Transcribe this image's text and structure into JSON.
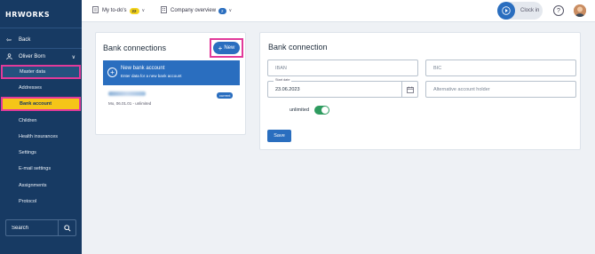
{
  "app": {
    "logo": "HRWORKS"
  },
  "sidebar": {
    "back_label": "Back",
    "user_label": "Oliver Born",
    "items": [
      {
        "label": "Master data"
      },
      {
        "label": "Addresses"
      },
      {
        "label": "Bank account"
      },
      {
        "label": "Children"
      },
      {
        "label": "Health insurances"
      },
      {
        "label": "Settings"
      },
      {
        "label": "E-mail settings"
      },
      {
        "label": "Assignments"
      },
      {
        "label": "Protocol"
      }
    ],
    "search_placeholder": "Search"
  },
  "topbar": {
    "todos_label": "My to-do's",
    "todos_count": "22",
    "company_label": "Company overview",
    "company_count": "2",
    "clockin_label": "Clock in",
    "help_label": "?"
  },
  "bank_connections": {
    "title": "Bank connections",
    "new_label": "New",
    "new_card_title": "New bank account",
    "new_card_subtitle": "Enter data for a new bank account",
    "account_date": "Mo, 06.01.01 - unlimited",
    "current_badge": "current"
  },
  "bank_connection": {
    "title": "Bank connection",
    "iban_placeholder": "IBAN",
    "bic_placeholder": "BIC",
    "start_date_label": "Start date",
    "start_date_value": "23.06.2023",
    "holder_placeholder": "Alternative account holder",
    "unlimited_label": "unlimited",
    "unlimited_on": true,
    "save_label": "Save"
  },
  "colors": {
    "sidebar": "#173a63",
    "primary": "#2a6ebf",
    "highlight": "#e23a9a",
    "active": "#f5c518",
    "toggle": "#2e9b5f"
  }
}
